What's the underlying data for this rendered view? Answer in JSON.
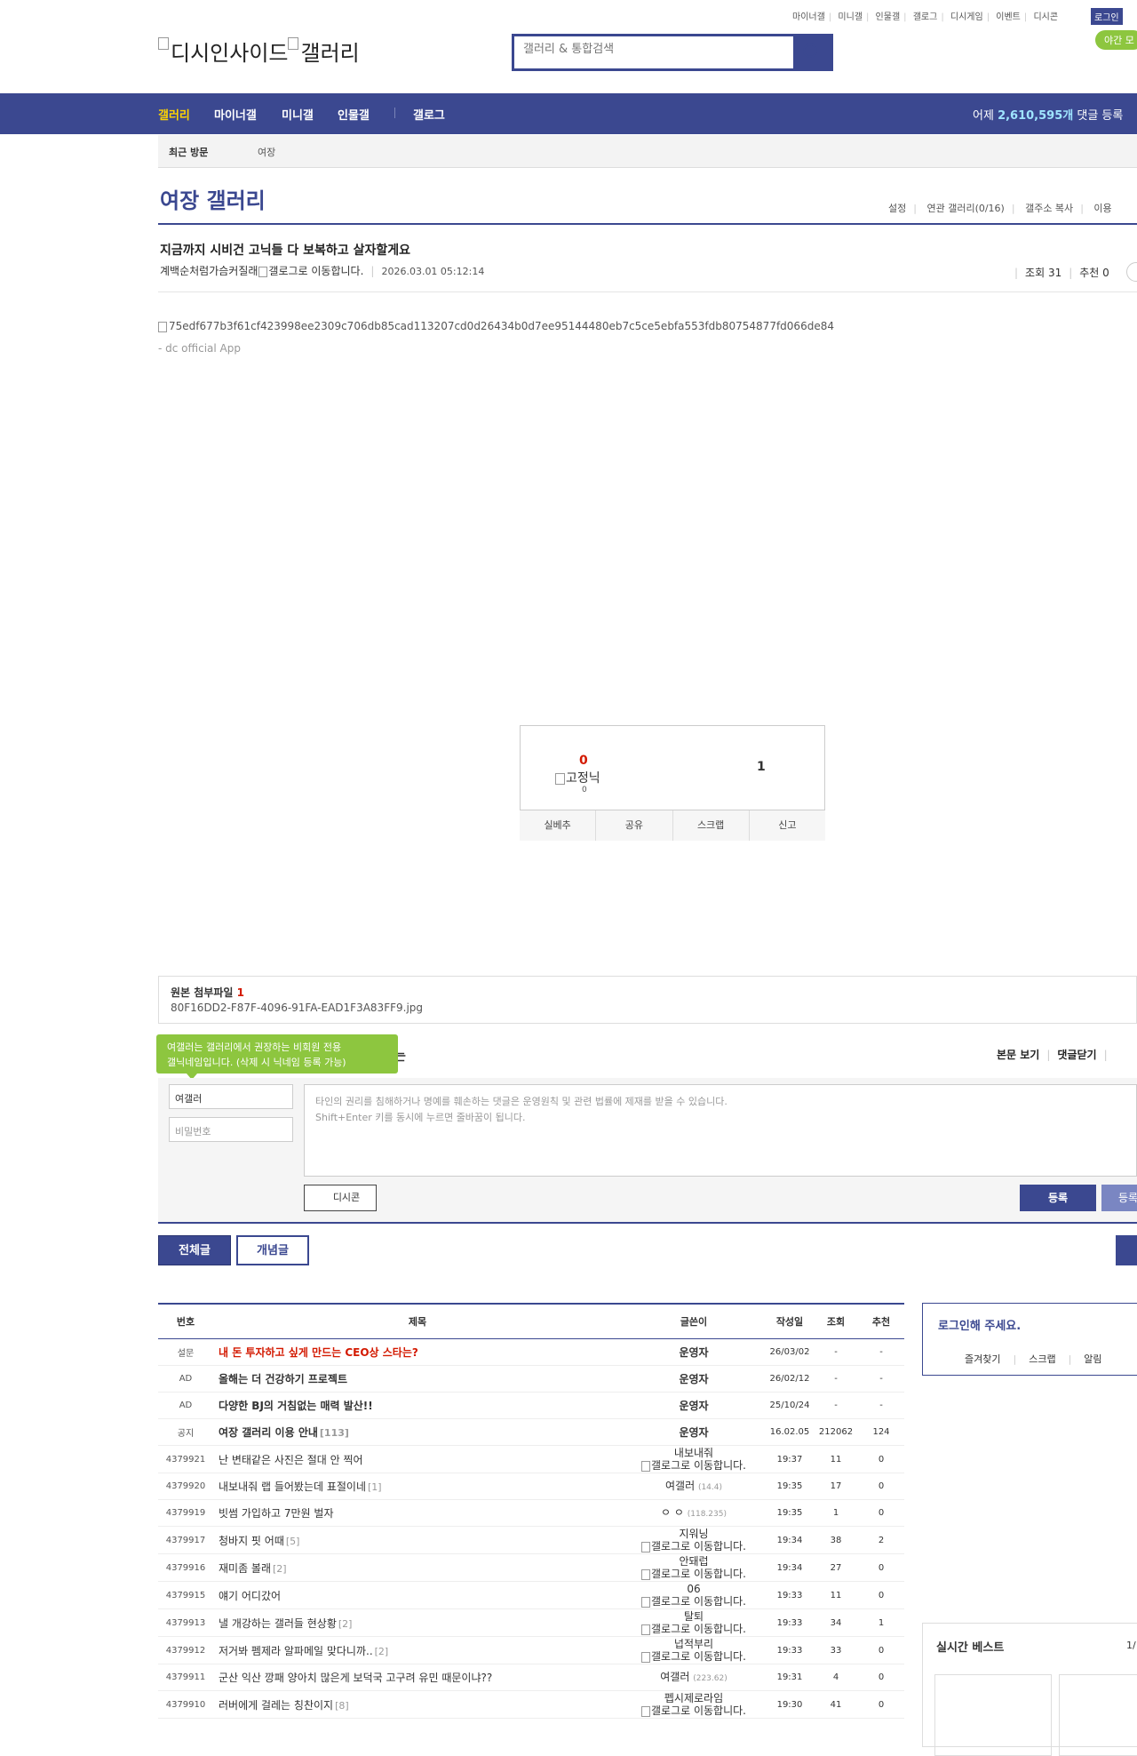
{
  "top_links": [
    "마이너갤",
    "미니갤",
    "인물갤",
    "갤로그",
    "디시게임",
    "이벤트",
    "디시콘"
  ],
  "login_label": "로그인",
  "night_mode_label": "야간 모",
  "logo_text_1": "디시인사이드",
  "logo_text_2": "갤러리",
  "search": {
    "placeholder": "갤러리 & 통합검색"
  },
  "nav": {
    "items": [
      "갤러리",
      "마이너갤",
      "미니갤",
      "인물갤",
      "갤로그"
    ],
    "yesterday_prefix": "어제",
    "yesterday_count": "2,610,595개",
    "yesterday_suffix": "댓글 등록"
  },
  "recent": {
    "label": "최근 방문",
    "item": "여장"
  },
  "gallery": {
    "title": "여장 갤러리",
    "links": [
      "설정",
      "연관 갤러리(0/16)",
      "갤주소 복사",
      "이용"
    ]
  },
  "post": {
    "title": "지금까지 시비건 고닉들 다 보복하고 살자할게요",
    "author": "계백순처럼가슴커질래",
    "author_icon_alt": "갤로그로 이동합니다.",
    "date": "2026.03.01 05:12:14",
    "views_label": "조회 31",
    "recommend_label": "추천 0",
    "image_alt": "75edf677b3f61cf423998ee2309c706db85cad113207cd0d26434b0d7ee95144480eb7c5ce5ebfa553fdb80754877fd066de84",
    "app_sign": "- dc official App"
  },
  "recommend_box": {
    "up_count": "0",
    "fixed_nick_alt": "고정닉",
    "fixed_nick_count": "0",
    "down_count": "1",
    "buttons": [
      "실베추",
      "공유",
      "스크랩",
      "신고"
    ]
  },
  "attachment": {
    "title": "원본 첨부파일",
    "count": "1",
    "filename": "80F16DD2-F87F-4096-91FA-EAD1F3A83FF9.jpg"
  },
  "comment": {
    "tooltip_line1": "여갤러는 갤러리에서 권장하는 비회원 전용",
    "tooltip_line2": "갤닉네임입니다. (삭제 시 닉네임 등록 가능)",
    "title_tail": "는",
    "links": [
      "본문 보기",
      "댓글닫기"
    ],
    "nick_value": "여갤러",
    "password_placeholder": "비밀번호",
    "text_placeholder_1": "타인의 권리를 침해하거나 명예를 훼손하는 댓글은 운영원칙 및 관련 법률에 제재를 받을 수 있습니다.",
    "text_placeholder_2": "Shift+Enter 키를 동시에 누르면 줄바꿈이 됩니다.",
    "dccon_label": "디시콘",
    "register_label": "등록",
    "register2_label": "등록"
  },
  "tabs": {
    "all": "전체글",
    "concept": "개념글"
  },
  "table": {
    "headers": [
      "번호",
      "제목",
      "글쓴이",
      "작성일",
      "조회",
      "추천"
    ],
    "rows": [
      {
        "num": "설문",
        "title": "내 돈 투자하고 싶게 만드는 CEO상 스타는?",
        "replies": "",
        "style": "red",
        "writer": "운영자",
        "writer_type": "bold",
        "ip": "",
        "date": "26/03/02",
        "views": "-",
        "rec": "-"
      },
      {
        "num": "AD",
        "title": "올해는 더 건강하기 프로젝트",
        "replies": "",
        "style": "bold",
        "writer": "운영자",
        "writer_type": "bold",
        "ip": "",
        "date": "26/02/12",
        "views": "-",
        "rec": "-"
      },
      {
        "num": "AD",
        "title": "다양한 BJ의 거침없는 매력 발산!!",
        "replies": "",
        "style": "bold",
        "writer": "운영자",
        "writer_type": "bold",
        "ip": "",
        "date": "25/10/24",
        "views": "-",
        "rec": "-"
      },
      {
        "num": "공지",
        "title": "여장 갤러리 이용 안내",
        "replies": "[113]",
        "style": "bold",
        "writer": "운영자",
        "writer_type": "bold",
        "ip": "",
        "date": "16.02.05",
        "views": "212062",
        "rec": "124"
      },
      {
        "num": "4379921",
        "title": "난 변태같은 사진은 절대 안 찍어",
        "replies": "",
        "style": "",
        "writer": "내보내줘",
        "writer_type": "galog",
        "ip": "",
        "date": "19:37",
        "views": "11",
        "rec": "0"
      },
      {
        "num": "4379920",
        "title": "내보내줘 랩 들어봤는데 표절이네",
        "replies": "[1]",
        "style": "",
        "writer": "여갤러",
        "writer_type": "ip",
        "ip": "(14.4)",
        "date": "19:35",
        "views": "17",
        "rec": "0"
      },
      {
        "num": "4379919",
        "title": "빗썸 가입하고 7만원 벌자",
        "replies": "",
        "style": "",
        "writer": "ㅇ ㅇ",
        "writer_type": "ip",
        "ip": "(118.235)",
        "date": "19:35",
        "views": "1",
        "rec": "0"
      },
      {
        "num": "4379917",
        "title": "청바지 핏 어때",
        "replies": "[5]",
        "style": "",
        "writer": "지워닝",
        "writer_type": "galog",
        "ip": "",
        "date": "19:34",
        "views": "38",
        "rec": "2"
      },
      {
        "num": "4379916",
        "title": "재미좀 볼래",
        "replies": "[2]",
        "style": "",
        "writer": "안돼럽",
        "writer_type": "galog",
        "ip": "",
        "date": "19:34",
        "views": "27",
        "rec": "0"
      },
      {
        "num": "4379915",
        "title": "얘기 어디갔어",
        "replies": "",
        "style": "",
        "writer": "06",
        "writer_type": "galog",
        "ip": "",
        "date": "19:33",
        "views": "11",
        "rec": "0"
      },
      {
        "num": "4379913",
        "title": "낼 개강하는 갤러들 현상황",
        "replies": "[2]",
        "style": "",
        "writer": "탈퇴",
        "writer_type": "galog",
        "ip": "",
        "date": "19:33",
        "views": "34",
        "rec": "1"
      },
      {
        "num": "4379912",
        "title": "저거봐 펨제라 알파메일 맞다니까..",
        "replies": "[2]",
        "style": "",
        "writer": "넙적부리",
        "writer_type": "galog",
        "ip": "",
        "date": "19:33",
        "views": "33",
        "rec": "0"
      },
      {
        "num": "4379911",
        "title": "군산 익산 깡패 양아치 많은게 보덕국 고구려 유민 때문이냐??",
        "replies": "",
        "style": "",
        "writer": "여갤러",
        "writer_type": "ip",
        "ip": "(223.62)",
        "date": "19:31",
        "views": "4",
        "rec": "0"
      },
      {
        "num": "4379910",
        "title": "러버에게 걸레는 칭찬이지",
        "replies": "[8]",
        "style": "",
        "writer": "펩시제로라임",
        "writer_type": "galog",
        "ip": "",
        "date": "19:30",
        "views": "41",
        "rec": "0"
      }
    ],
    "galog_alt": "갤로그로 이동합니다."
  },
  "sidebar": {
    "login_prompt": "로그인해 주세요.",
    "login_links": [
      "즐겨찾기",
      "스크랩",
      "알림"
    ],
    "best_title": "실시간 베스트",
    "best_page": "1/"
  },
  "colors": {
    "brand": "#3b4890",
    "accent_yellow": "#ffd400",
    "alert_red": "#d31900",
    "green": "#8dc63f"
  }
}
